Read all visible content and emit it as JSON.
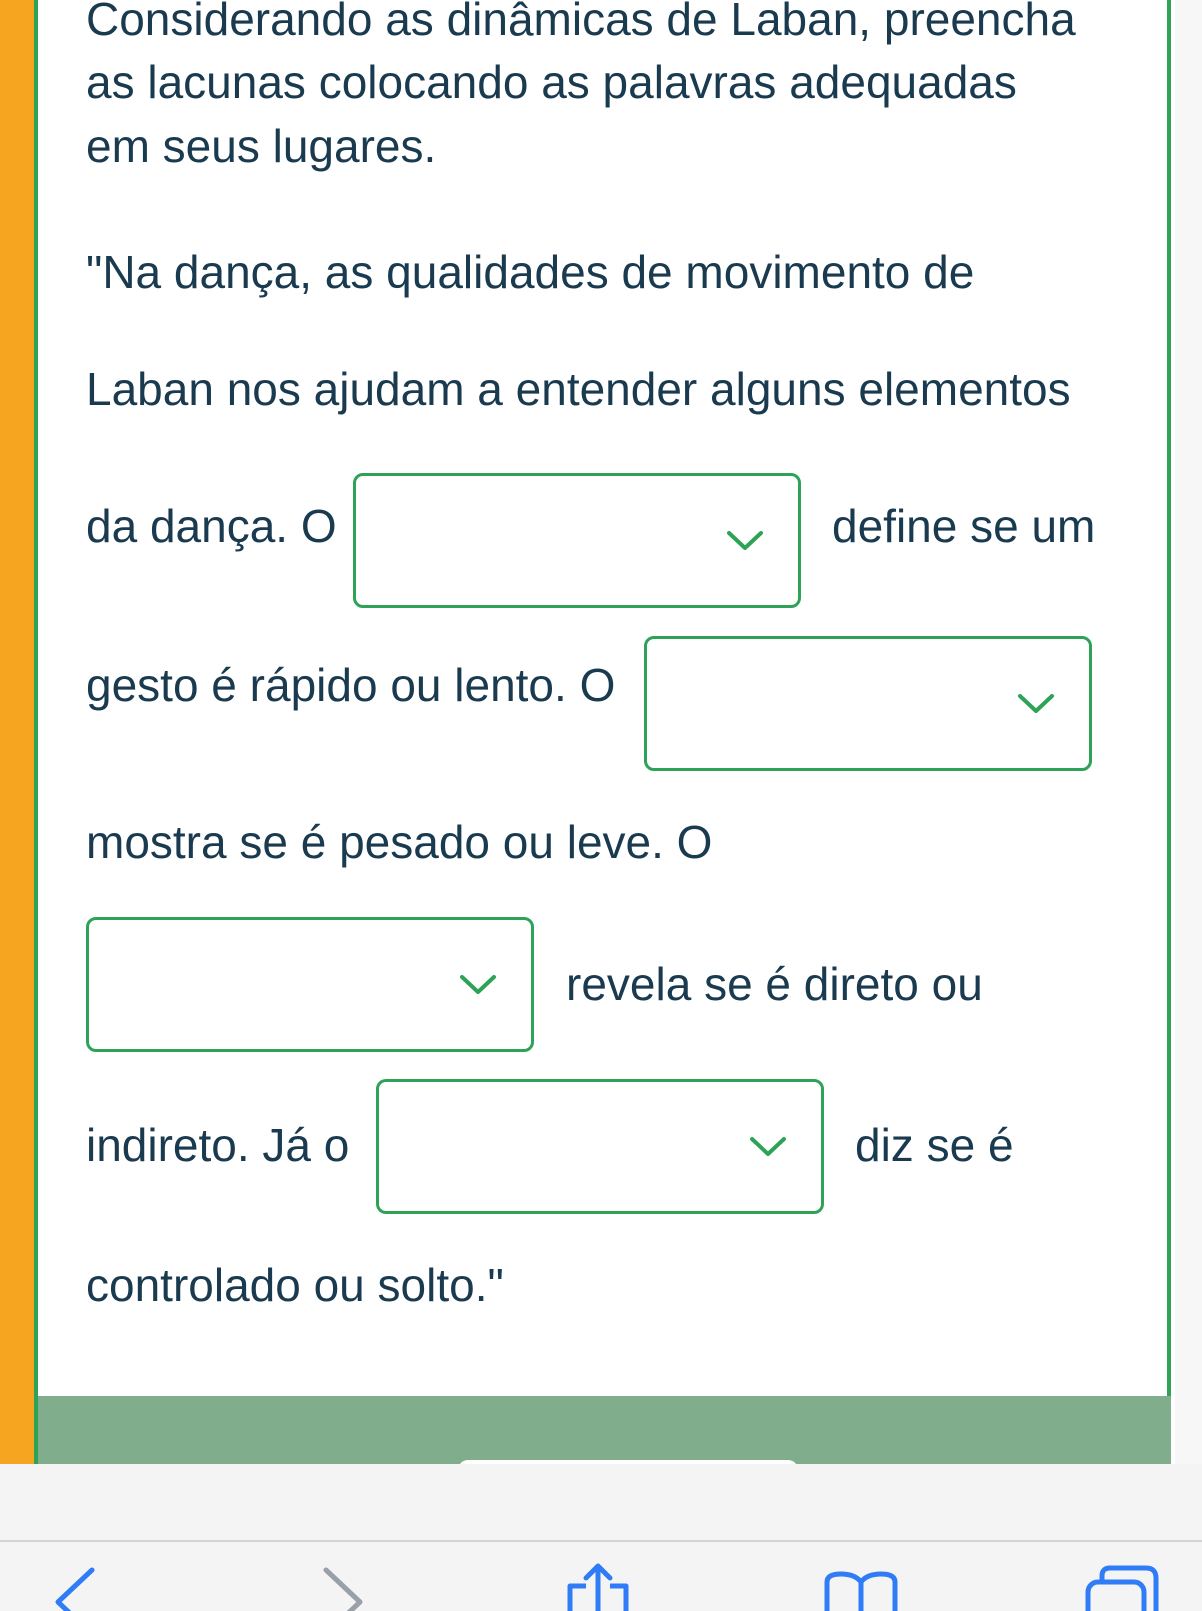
{
  "instruction": {
    "line1": "Considerando as dinâmicas de Laban, preencha",
    "line2": "as lacunas colocando as palavras adequadas",
    "line3": "em seus lugares."
  },
  "passage": {
    "line1": "\"Na dança, as qualidades de movimento de",
    "line2": "Laban nos ajudam a entender alguns elementos",
    "line3_before": "da dança. O",
    "line3_after": "define se um",
    "line4_before": "gesto é rápido ou lento. O",
    "line5": "mostra se é pesado ou leve. O",
    "line6_after": "revela se é direto ou",
    "line7_before": "indireto. Já o",
    "line7_after": "diz se é",
    "line8": "controlado ou solto.\""
  },
  "dropdowns": [
    {
      "selected": ""
    },
    {
      "selected": ""
    },
    {
      "selected": ""
    },
    {
      "selected": ""
    }
  ],
  "colors": {
    "accent_green": "#2ea357",
    "left_strip_orange": "#f6a520",
    "footer_bar_green": "#80ae8c",
    "text": "#1a3a4f",
    "toolbar_icon_blue": "#2f7cf6"
  },
  "toolbar": {
    "icons": [
      "back-icon",
      "forward-icon",
      "share-icon",
      "bookmarks-icon",
      "tabs-icon"
    ]
  }
}
